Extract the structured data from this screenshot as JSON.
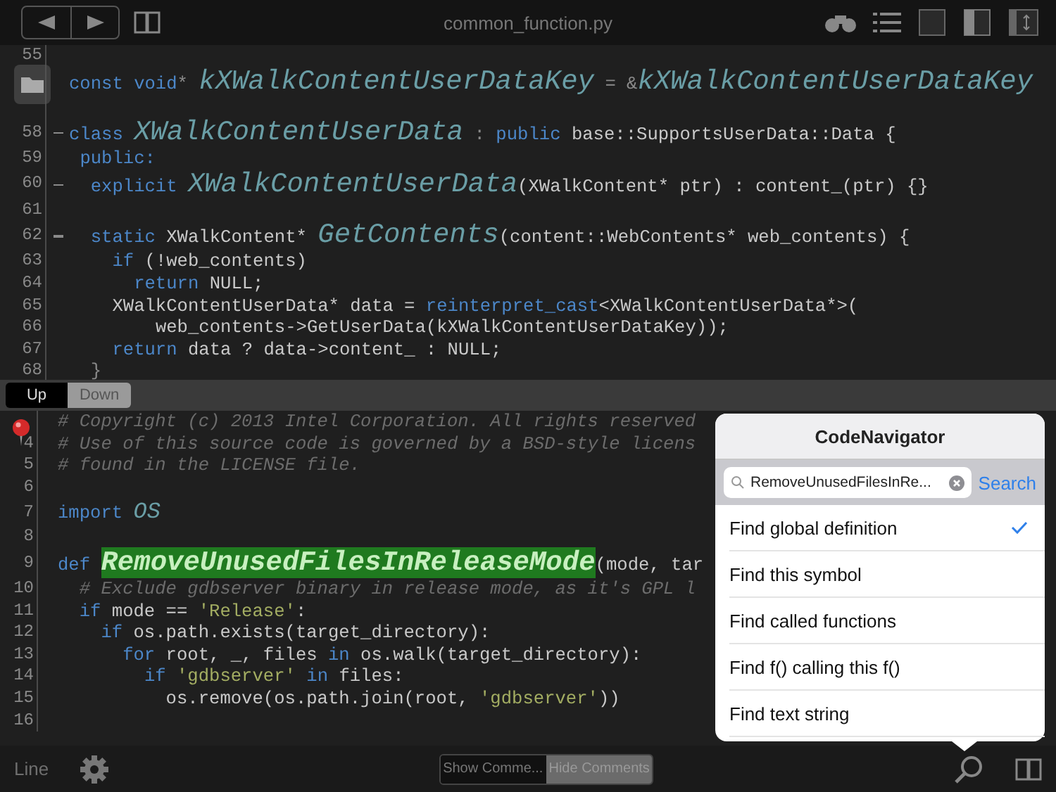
{
  "toolbar": {
    "title": "common_function.py"
  },
  "upper_pane": {
    "lines": [
      {
        "num": "55",
        "fold": false
      },
      {
        "fold": false,
        "code": [
          {
            "kind": "kw",
            "text": "const void"
          },
          {
            "kind": "op",
            "text": "* "
          },
          {
            "kind": "fn",
            "text": "kXWalkContentUserDataKey"
          },
          {
            "kind": "op",
            "text": " = &"
          },
          {
            "kind": "fn",
            "text": "kXWalkContentUserDataKey"
          }
        ]
      },
      {
        "fold": false
      },
      {
        "num": "58",
        "fold": true,
        "code": [
          {
            "kind": "kw",
            "text": "class "
          },
          {
            "kind": "fn",
            "text": "XWalkContentUserData"
          },
          {
            "kind": "op",
            "text": " : "
          },
          {
            "kind": "kw",
            "text": "public "
          },
          {
            "kind": "id",
            "text": "base::SupportsUserData::Data {"
          }
        ]
      },
      {
        "num": "59",
        "fold": false,
        "code": [
          {
            "kind": "kw",
            "text": " public:"
          }
        ]
      },
      {
        "num": "60",
        "fold": true,
        "code": [
          {
            "kind": "kw",
            "text": "  explicit "
          },
          {
            "kind": "fn",
            "text": "XWalkContentUserData"
          },
          {
            "kind": "id",
            "text": "(XWalkContent* ptr) : content_(ptr) {}"
          }
        ]
      },
      {
        "num": "61",
        "fold": false
      },
      {
        "num": "62",
        "fold": true,
        "code": [
          {
            "kind": "kw",
            "text": "  static "
          },
          {
            "kind": "id",
            "text": "XWalkContent* "
          },
          {
            "kind": "fn",
            "text": "GetContents"
          },
          {
            "kind": "id",
            "text": "(content::WebContents* web_contents) {"
          }
        ]
      },
      {
        "num": "63",
        "fold": false,
        "code": [
          {
            "kind": "kw",
            "text": "    if "
          },
          {
            "kind": "id",
            "text": "(!web_contents)"
          }
        ]
      },
      {
        "num": "64",
        "fold": false,
        "code": [
          {
            "kind": "kw",
            "text": "      return "
          },
          {
            "kind": "id",
            "text": "NULL;"
          }
        ]
      },
      {
        "num": "65",
        "fold": false,
        "code": [
          {
            "kind": "id",
            "text": "    XWalkContentUserData* data = "
          },
          {
            "kind": "kw",
            "text": "reinterpret_cast"
          },
          {
            "kind": "id",
            "text": "<XWalkContentUserData*>("
          }
        ]
      },
      {
        "num": "66",
        "fold": false,
        "code": [
          {
            "kind": "id",
            "text": "        web_contents->GetUserData(kXWalkContentUserDataKey));"
          }
        ]
      },
      {
        "num": "67",
        "fold": false,
        "code": [
          {
            "kind": "kw",
            "text": "    return "
          },
          {
            "kind": "id",
            "text": "data ? data->content_ : NULL;"
          }
        ]
      },
      {
        "num": "68",
        "fold": false,
        "code": [
          {
            "kind": "op",
            "text": "  }"
          }
        ]
      }
    ]
  },
  "pane_switcher": [
    {
      "label": "Up",
      "selected": true
    },
    {
      "label": "Down",
      "selected": false
    }
  ],
  "lower_pane": {
    "lines": [
      {
        "kind": "breakpoint",
        "code": [
          {
            "kind": "cmt",
            "text": "# Copyright (c) 2013 Intel Corporation. All rights reserved"
          }
        ]
      },
      {
        "num": "4",
        "code": [
          {
            "kind": "cmt",
            "text": "# Use of this source code is governed by a BSD-style licens"
          }
        ]
      },
      {
        "num": "5",
        "code": [
          {
            "kind": "cmt",
            "text": "# found in the LICENSE file."
          }
        ]
      },
      {
        "num": "6"
      },
      {
        "num": "7",
        "code": [
          {
            "kind": "kw",
            "text": "import "
          },
          {
            "kind": "name",
            "text": "OS"
          }
        ]
      },
      {
        "num": "8"
      },
      {
        "num": "9",
        "code": [
          {
            "kind": "kw",
            "text": "def "
          },
          {
            "kind": "hl",
            "text": "RemoveUnusedFilesInReleaseMode"
          },
          {
            "kind": "id",
            "text": "(mode, tar"
          }
        ]
      },
      {
        "num": "10",
        "code": [
          {
            "kind": "cmt",
            "text": "  # Exclude gdbserver binary in release mode, as it's GPL l"
          }
        ]
      },
      {
        "num": "11",
        "code": [
          {
            "kind": "kw",
            "text": "  if"
          },
          {
            "kind": "id",
            "text": " mode == "
          },
          {
            "kind": "str",
            "text": "'Release'"
          },
          {
            "kind": "id",
            "text": ":"
          }
        ]
      },
      {
        "num": "12",
        "code": [
          {
            "kind": "kw",
            "text": "    if"
          },
          {
            "kind": "id",
            "text": " os.path.exists(target_directory):"
          }
        ]
      },
      {
        "num": "13",
        "code": [
          {
            "kind": "kw",
            "text": "      for"
          },
          {
            "kind": "id",
            "text": " root, _, files "
          },
          {
            "kind": "kw",
            "text": "in"
          },
          {
            "kind": "id",
            "text": " os.walk(target_directory):"
          }
        ]
      },
      {
        "num": "14",
        "code": [
          {
            "kind": "kw",
            "text": "        if "
          },
          {
            "kind": "str",
            "text": "'gdbserver'"
          },
          {
            "kind": "kw",
            "text": " in"
          },
          {
            "kind": "id",
            "text": " files:"
          }
        ]
      },
      {
        "num": "15",
        "code": [
          {
            "kind": "id",
            "text": "          os.remove(os.path.join(root, "
          },
          {
            "kind": "str",
            "text": "'gdbserver'"
          },
          {
            "kind": "id",
            "text": "))"
          }
        ]
      },
      {
        "num": "16"
      }
    ]
  },
  "bottom_bar": {
    "line_label": "Line",
    "comment_toggle": [
      {
        "label": "Show Comme...",
        "selected": true
      },
      {
        "label": "Hide Comments",
        "selected": false
      }
    ]
  },
  "popover": {
    "title": "CodeNavigator",
    "search": {
      "value": "RemoveUnusedFilesInRe...",
      "button": "Search"
    },
    "options": [
      {
        "label": "Find global definition",
        "selected": true
      },
      {
        "label": "Find this symbol",
        "selected": false
      },
      {
        "label": "Find called functions",
        "selected": false
      },
      {
        "label": "Find f() calling this f()",
        "selected": false
      },
      {
        "label": "Find text string",
        "selected": false
      }
    ]
  }
}
